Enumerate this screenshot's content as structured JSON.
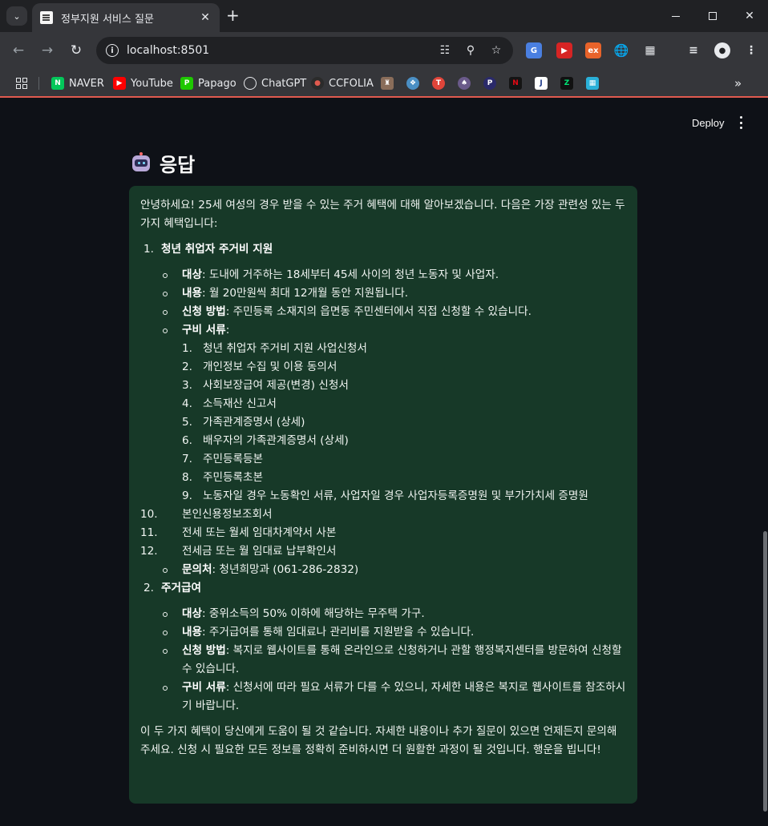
{
  "browser": {
    "tab_title": "정부지원 서비스 질문",
    "url": "localhost:8501",
    "bookmarks": [
      {
        "label": "NAVER",
        "icon": "naver-icon",
        "color": "#03c75a"
      },
      {
        "label": "YouTube",
        "icon": "youtube-icon",
        "color": "#ff0000"
      },
      {
        "label": "Papago",
        "icon": "papago-icon",
        "color": "#1ec800"
      },
      {
        "label": "ChatGPT",
        "icon": "chatgpt-icon",
        "color": "#ffffff"
      },
      {
        "label": "CCFOLIA",
        "icon": "ccfolia-icon",
        "color": "#c0392b"
      }
    ]
  },
  "app": {
    "deploy_label": "Deploy",
    "heading": "응답",
    "intro": "안녕하세요! 25세 여성의 경우 받을 수 있는 주거 혜택에 대해 알아보겠습니다. 다음은 가장 관련성 있는 두 가지 혜택입니다:",
    "benefits": [
      {
        "num": "1.",
        "title": "청년 취업자 주거비 지원",
        "target_label": "대상",
        "target": ": 도내에 거주하는 18세부터 45세 사이의 청년 노동자 및 사업자.",
        "content_label": "내용",
        "content": ": 월 20만원씩 최대 12개월 동안 지원됩니다.",
        "apply_label": "신청 방법",
        "apply": ": 주민등록 소재지의 읍면동 주민센터에서 직접 신청할 수 있습니다.",
        "docs_label": "구비 서류",
        "docs_suffix": ":",
        "docs": [
          "청년 취업자 주거비 지원 사업신청서",
          "개인정보 수집 및 이용 동의서",
          "사회보장급여 제공(변경) 신청서",
          "소득재산 신고서",
          "가족관계증명서 (상세)",
          "배우자의 가족관계증명서 (상세)",
          "주민등록등본",
          "주민등록초본",
          "노동자일 경우 노동확인 서류, 사업자일 경우 사업자등록증명원 및 부가가치세 증명원"
        ],
        "docs_extra": [
          {
            "num": "10.",
            "text": "본인신용정보조회서"
          },
          {
            "num": "11.",
            "text": "전세 또는 월세 임대차계약서 사본"
          },
          {
            "num": "12.",
            "text": "전세금 또는 월 임대료 납부확인서"
          }
        ],
        "contact_label": "문의처",
        "contact": ": 청년희망과 (061-286-2832)"
      },
      {
        "num": "2.",
        "title": "주거급여",
        "target_label": "대상",
        "target": ": 중위소득의 50% 이하에 해당하는 무주택 가구.",
        "content_label": "내용",
        "content": ": 주거급여를 통해 임대료나 관리비를 지원받을 수 있습니다.",
        "apply_label": "신청 방법",
        "apply": ": 복지로 웹사이트를 통해 온라인으로 신청하거나 관할 행정복지센터를 방문하여 신청할 수 있습니다.",
        "docs_label": "구비 서류",
        "docs": ": 신청서에 따라 필요 서류가 다를 수 있으니, 자세한 내용은 복지로 웹사이트를 참조하시기 바랍니다."
      }
    ],
    "outro": "이 두 가지 혜택이 당신에게 도움이 될 것 같습니다. 자세한 내용이나 추가 질문이 있으면 언제든지 문의해 주세요. 신청 시 필요한 모든 정보를 정확히 준비하시면 더 원활한 과정이 될 것입니다. 행운을 빕니다!"
  }
}
